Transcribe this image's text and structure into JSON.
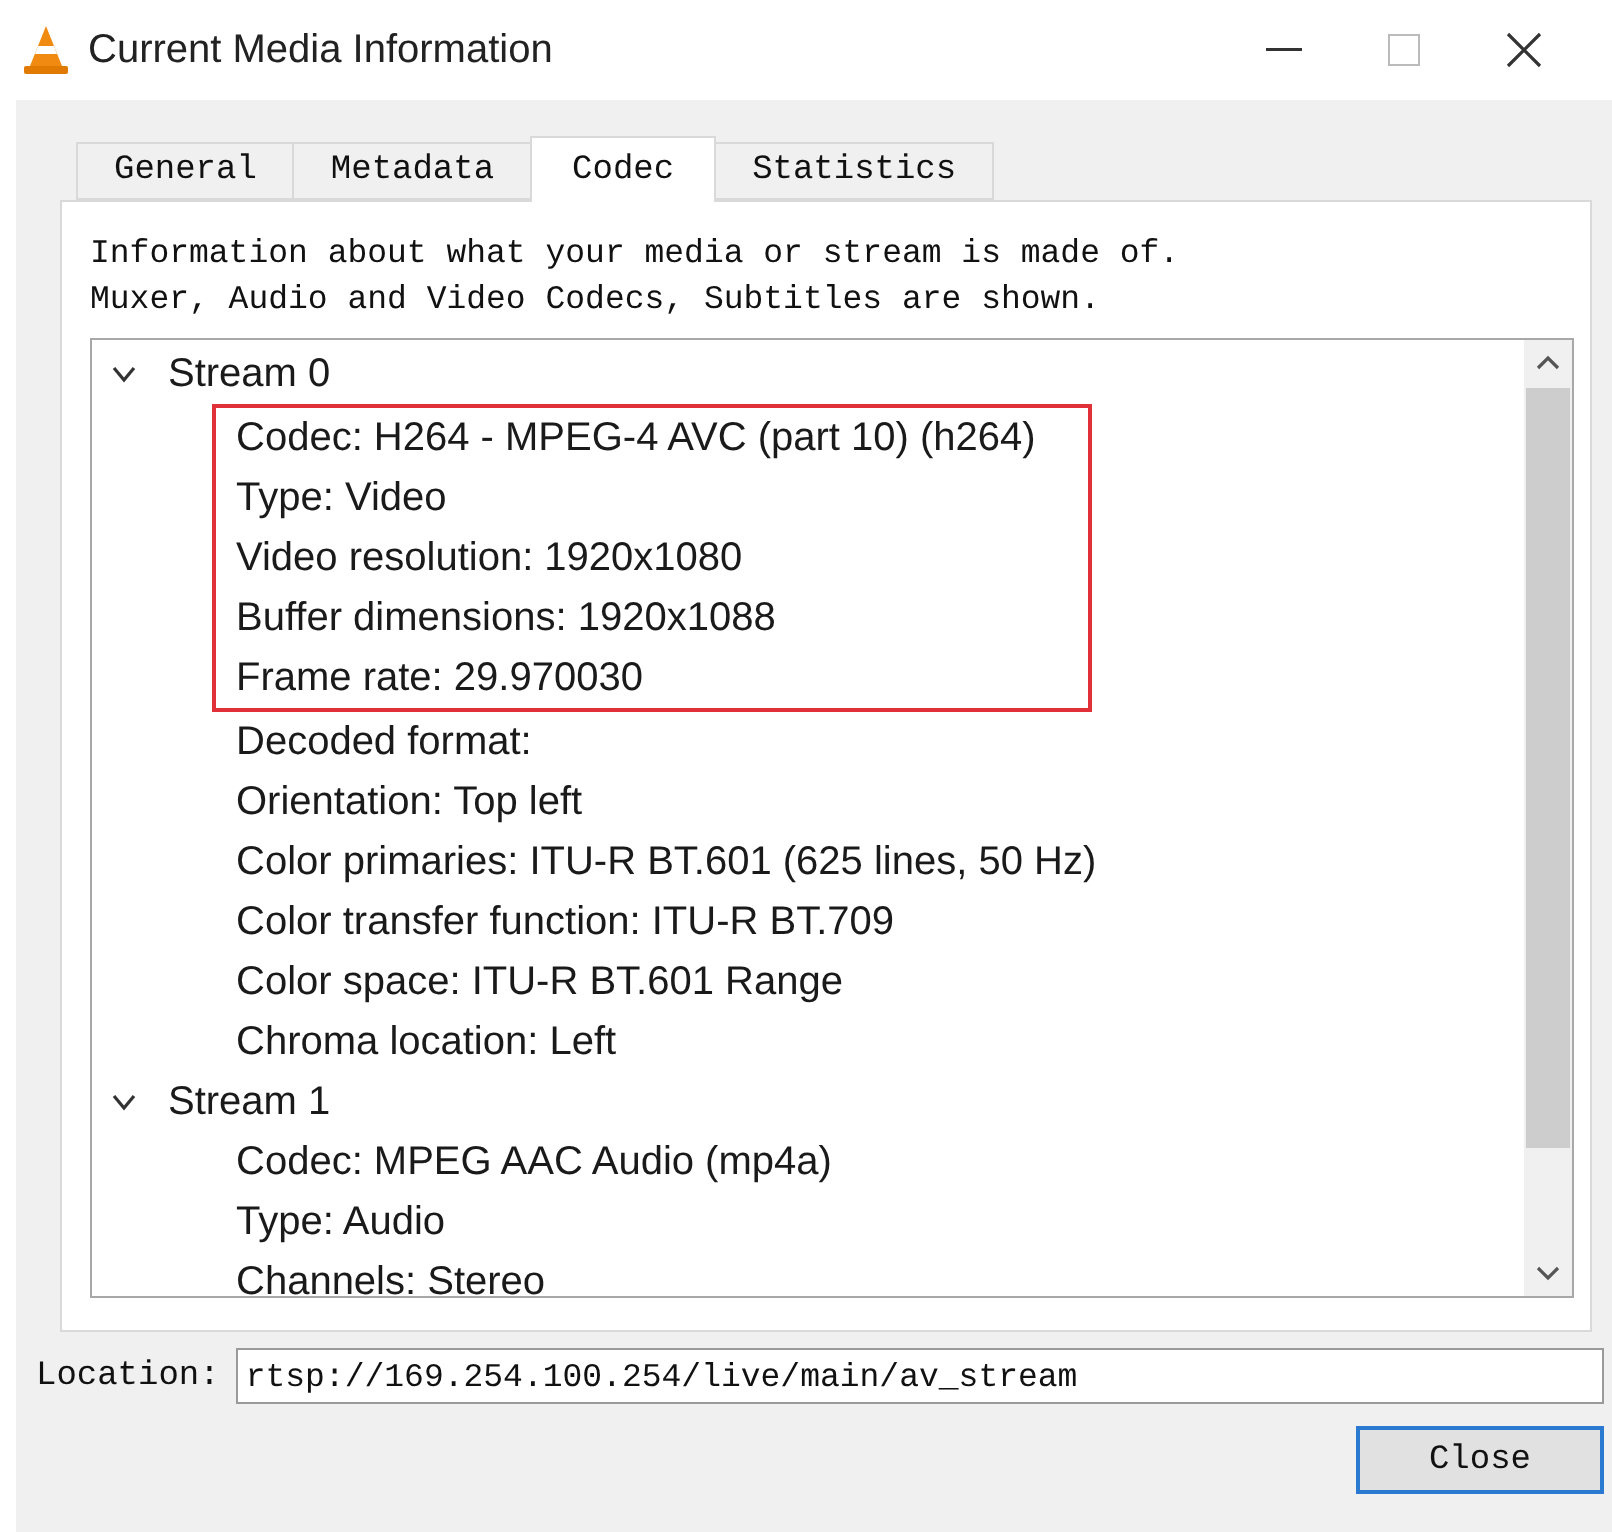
{
  "window": {
    "title": "Current Media Information"
  },
  "tabs": [
    {
      "label": "General",
      "selected": false
    },
    {
      "label": "Metadata",
      "selected": false
    },
    {
      "label": "Codec",
      "selected": true
    },
    {
      "label": "Statistics",
      "selected": false
    }
  ],
  "description": [
    "Information about what your media or stream is made of.",
    "Muxer, Audio and Video Codecs, Subtitles are shown."
  ],
  "tree": [
    {
      "label": "Stream 0",
      "expanded": true,
      "highlighted_items": [
        "Codec: H264 - MPEG-4 AVC (part 10) (h264)",
        "Type: Video",
        "Video resolution: 1920x1080",
        "Buffer dimensions: 1920x1088",
        "Frame rate: 29.970030"
      ],
      "children": [
        "Decoded format:",
        "Orientation: Top left",
        "Color primaries: ITU-R BT.601 (625 lines, 50 Hz)",
        "Color transfer function: ITU-R BT.709",
        "Color space: ITU-R BT.601 Range",
        "Chroma location: Left"
      ]
    },
    {
      "label": "Stream 1",
      "expanded": true,
      "children": [
        "Codec: MPEG AAC Audio (mp4a)",
        "Type: Audio",
        "Channels: Stereo"
      ]
    }
  ],
  "location": {
    "label": "Location:",
    "value": "rtsp://169.254.100.254/live/main/av_stream"
  },
  "buttons": [
    {
      "label": "Close"
    }
  ]
}
